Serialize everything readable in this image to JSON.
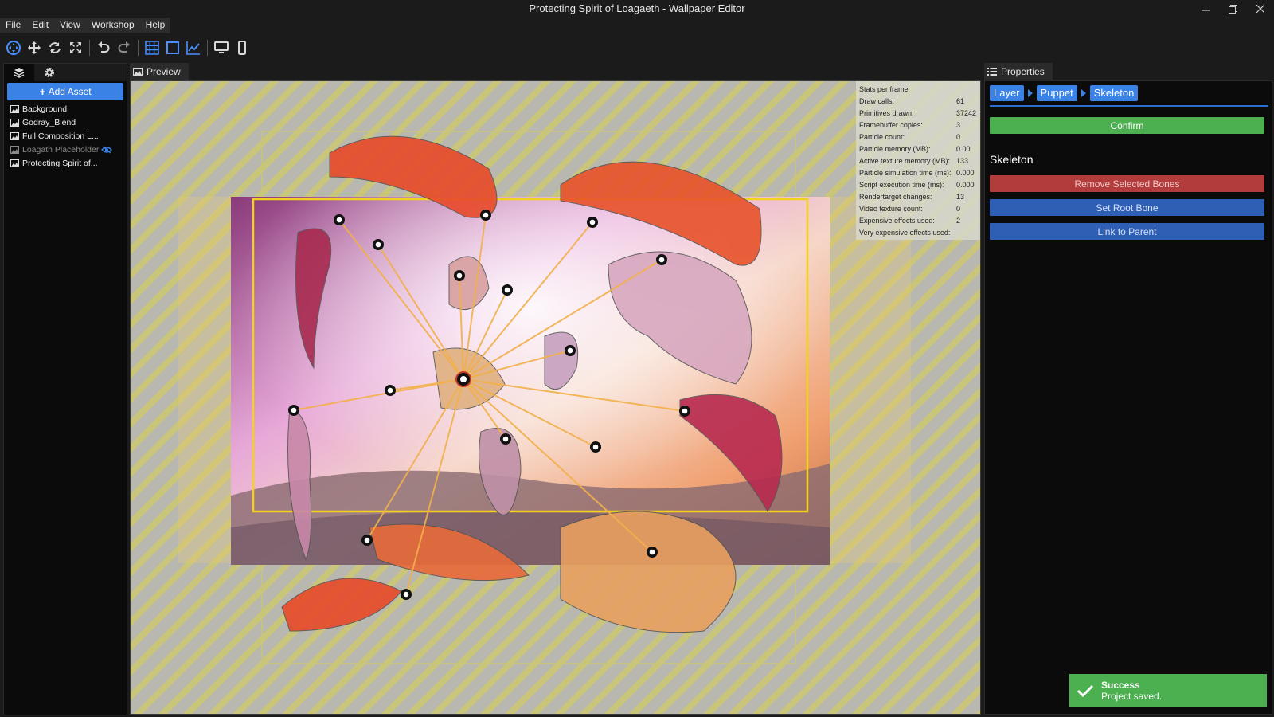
{
  "window": {
    "title": "Protecting Spirit of Loagaeth - Wallpaper Editor"
  },
  "menu": [
    "File",
    "Edit",
    "View",
    "Workshop",
    "Help"
  ],
  "toolbar": {
    "icons": [
      "gizmo-select-icon",
      "move-icon",
      "rotate-icon",
      "scale-icon",
      "undo-icon",
      "redo-icon",
      "grid-icon",
      "bounds-icon",
      "graph-icon",
      "desktop-icon",
      "mobile-icon"
    ]
  },
  "assets": {
    "add_label": "Add Asset",
    "items": [
      {
        "label": "Background"
      },
      {
        "label": "Godray_Blend"
      },
      {
        "label": "Full Composition L..."
      },
      {
        "label": "Loagath Placeholder"
      },
      {
        "label": "Protecting Spirit of..."
      }
    ]
  },
  "preview": {
    "tab_label": "Preview",
    "stats_title": "Stats per frame",
    "stats": [
      {
        "label": "Draw calls:",
        "value": "61"
      },
      {
        "label": "Primitives drawn:",
        "value": "37242"
      },
      {
        "label": "Framebuffer copies:",
        "value": "3"
      },
      {
        "label": "Particle count:",
        "value": "0"
      },
      {
        "label": "Particle memory (MB):",
        "value": "0.00"
      },
      {
        "label": "Active texture memory (MB):",
        "value": "133"
      },
      {
        "label": "Particle simulation time (ms):",
        "value": "0.000"
      },
      {
        "label": "Script execution time (ms):",
        "value": "0.000"
      },
      {
        "label": "Rendertarget changes:",
        "value": "13"
      },
      {
        "label": "Video texture count:",
        "value": "0"
      },
      {
        "label": "Expensive effects used:",
        "value": "2"
      },
      {
        "label": "Very expensive effects used:",
        "value": ""
      }
    ]
  },
  "properties": {
    "tab_label": "Properties",
    "breadcrumb": [
      "Layer",
      "Puppet",
      "Skeleton"
    ],
    "confirm_label": "Confirm",
    "section_title": "Skeleton",
    "remove_label": "Remove Selected Bones",
    "root_label": "Set Root Bone",
    "link_label": "Link to Parent"
  },
  "toast": {
    "title": "Success",
    "message": "Project saved."
  },
  "colors": {
    "accent": "#3b82e6",
    "success": "#4caf50",
    "danger": "#b23b3b"
  }
}
